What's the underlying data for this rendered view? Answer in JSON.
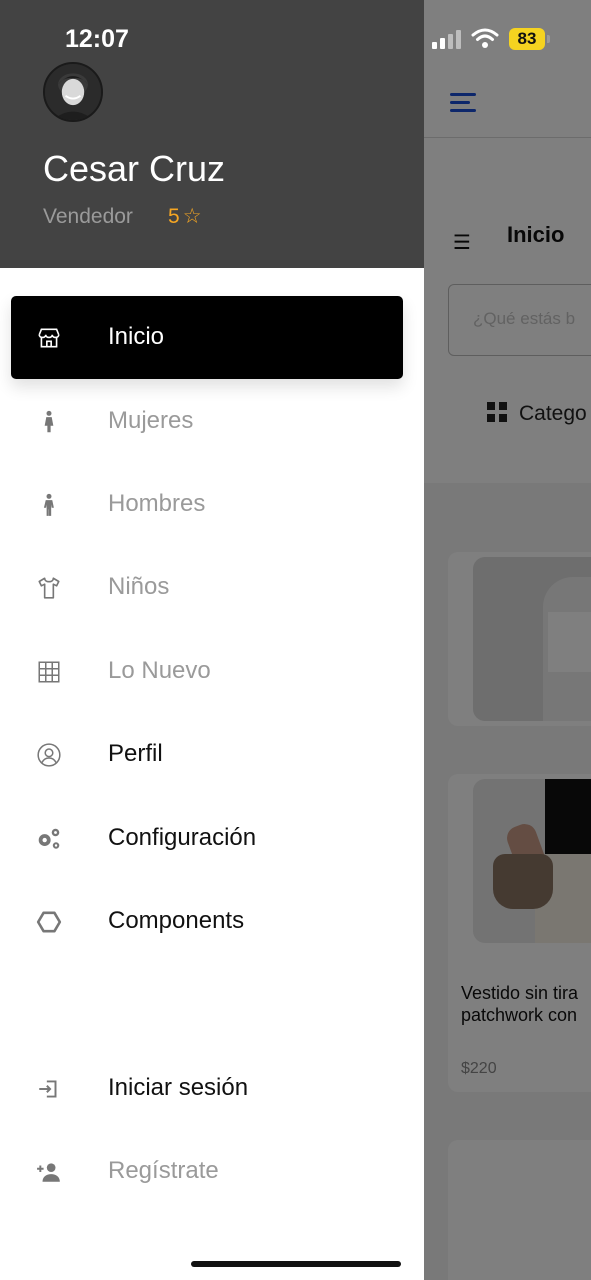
{
  "status_bar": {
    "time": "12:07",
    "battery": "83"
  },
  "background_app": {
    "screen_title": "Inicio",
    "search_placeholder": "¿Qué estás b",
    "categories_label": "Catego",
    "product": {
      "description_line1": "Vestido sin tira",
      "description_line2": "patchwork con",
      "price": "$220"
    }
  },
  "profile": {
    "name": "Cesar Cruz",
    "role": "Vendedor",
    "rating": "5"
  },
  "menu": {
    "items": [
      {
        "label": "Inicio",
        "icon": "store-icon",
        "state": "active"
      },
      {
        "label": "Mujeres",
        "icon": "woman-icon",
        "state": "muted"
      },
      {
        "label": "Hombres",
        "icon": "man-icon",
        "state": "muted"
      },
      {
        "label": "Niños",
        "icon": "tshirt-icon",
        "state": "muted"
      },
      {
        "label": "Lo Nuevo",
        "icon": "grid-icon",
        "state": "muted"
      },
      {
        "label": "Perfil",
        "icon": "user-circle-icon",
        "state": "dark"
      },
      {
        "label": "Configuración",
        "icon": "gears-icon",
        "state": "dark"
      },
      {
        "label": "Components",
        "icon": "hexagon-icon",
        "state": "dark"
      },
      {
        "label": "Iniciar sesión",
        "icon": "login-icon",
        "state": "dark"
      },
      {
        "label": "Regístrate",
        "icon": "user-plus-icon",
        "state": "muted"
      }
    ]
  },
  "colors": {
    "drawer_header": "#434343",
    "active_item": "#000000",
    "rating": "#f5a623",
    "battery": "#f5d320",
    "accent_blue": "#1a4fd6"
  }
}
